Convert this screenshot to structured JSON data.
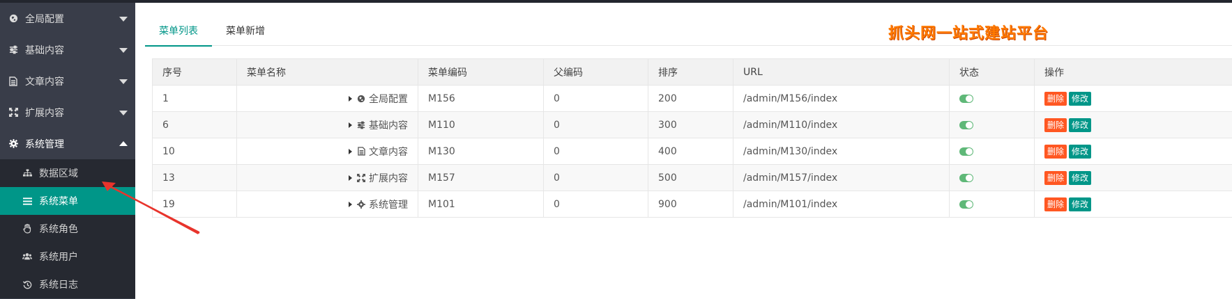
{
  "sidebar": {
    "menus": [
      {
        "label": "全局配置",
        "icon": "globe-icon",
        "open": false
      },
      {
        "label": "基础内容",
        "icon": "sliders-icon",
        "open": false
      },
      {
        "label": "文章内容",
        "icon": "document-icon",
        "open": false
      },
      {
        "label": "扩展内容",
        "icon": "expand-icon",
        "open": false
      },
      {
        "label": "系统管理",
        "icon": "gear-icon",
        "open": true
      }
    ],
    "submenu": [
      {
        "label": "数据区域",
        "icon": "sitemap-icon",
        "active": false
      },
      {
        "label": "系统菜单",
        "icon": "list-icon",
        "active": true
      },
      {
        "label": "系统角色",
        "icon": "hand-icon",
        "active": false
      },
      {
        "label": "系统用户",
        "icon": "users-icon",
        "active": false
      },
      {
        "label": "系统日志",
        "icon": "history-icon",
        "active": false
      }
    ]
  },
  "tabs": [
    {
      "label": "菜单列表",
      "active": true
    },
    {
      "label": "菜单新增",
      "active": false
    }
  ],
  "brand": {
    "text": "抓头网一站式建站平台"
  },
  "table": {
    "columns": [
      "序号",
      "菜单名称",
      "菜单编码",
      "父编码",
      "排序",
      "URL",
      "状态",
      "操作"
    ],
    "rows": [
      {
        "id": "1",
        "name": "全局配置",
        "icon": "globe-icon",
        "code": "M156",
        "parent": "0",
        "sort": "200",
        "url": "/admin/M156/index",
        "status": true
      },
      {
        "id": "6",
        "name": "基础内容",
        "icon": "sliders-icon",
        "code": "M110",
        "parent": "0",
        "sort": "300",
        "url": "/admin/M110/index",
        "status": true
      },
      {
        "id": "10",
        "name": "文章内容",
        "icon": "document-icon",
        "code": "M130",
        "parent": "0",
        "sort": "400",
        "url": "/admin/M130/index",
        "status": true
      },
      {
        "id": "13",
        "name": "扩展内容",
        "icon": "expand-icon",
        "code": "M157",
        "parent": "0",
        "sort": "500",
        "url": "/admin/M157/index",
        "status": true
      },
      {
        "id": "19",
        "name": "系统管理",
        "icon": "gear-icon",
        "code": "M101",
        "parent": "0",
        "sort": "900",
        "url": "/admin/M101/index",
        "status": true
      }
    ],
    "actions": {
      "delete": "删除",
      "edit": "修改"
    }
  },
  "colors": {
    "accent": "#009688",
    "sidebar": "#393d49",
    "delete": "#ff5722",
    "switch_on": "#5fb878",
    "brand": "#ff7a00",
    "annotation_arrow": "#e8342c"
  }
}
